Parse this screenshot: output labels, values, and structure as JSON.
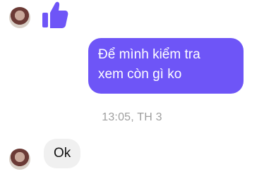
{
  "colors": {
    "accent": "#6e55f7",
    "incoming_bubble": "#f0f0f0",
    "timestamp": "#9e9e9e"
  },
  "messages": {
    "reaction": {
      "icon": "thumbs-up-icon"
    },
    "outgoing": {
      "line1": "Để mình kiểm tra",
      "line2": "xem còn gì ko"
    },
    "timestamp": "13:05, TH 3",
    "incoming": {
      "text": "Ok"
    }
  }
}
